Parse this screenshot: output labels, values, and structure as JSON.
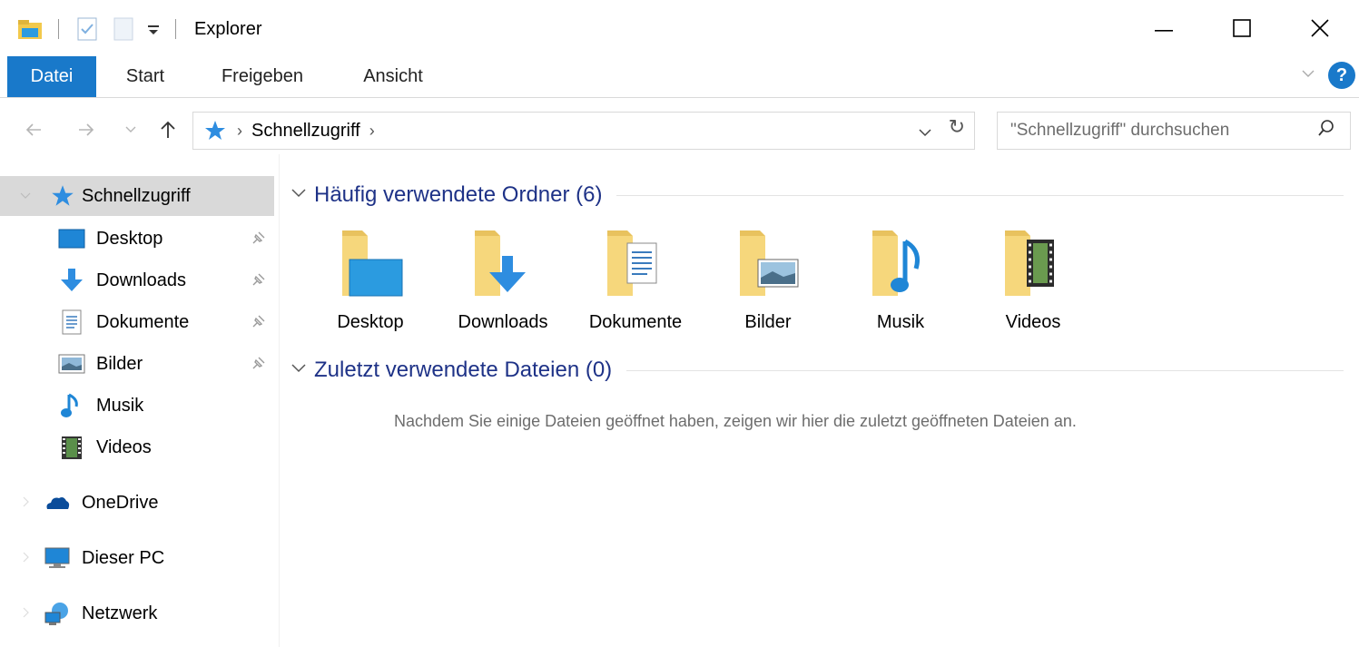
{
  "window": {
    "title": "Explorer",
    "controls": {
      "minimize": "—",
      "maximize": "☐",
      "close": "✕"
    }
  },
  "ribbon": {
    "tabs": [
      {
        "label": "Datei",
        "active": true
      },
      {
        "label": "Start",
        "active": false
      },
      {
        "label": "Freigeben",
        "active": false
      },
      {
        "label": "Ansicht",
        "active": false
      }
    ],
    "help": "?",
    "expand": "﹀"
  },
  "nav": {
    "back": "←",
    "forward": "→",
    "recent": "⌄",
    "up": "↑",
    "address_sep": "›",
    "address_location": "Schnellzugriff",
    "address_trailing_sep": "›",
    "dropdown": "⌄",
    "refresh": "↻",
    "search_placeholder": "\"Schnellzugriff\" durchsuchen",
    "search_icon": "⚲"
  },
  "sidebar": {
    "quick_access": "Schnellzugriff",
    "items": [
      {
        "label": "Desktop",
        "icon": "desktop-icon",
        "pinned": true
      },
      {
        "label": "Downloads",
        "icon": "downloads-icon",
        "pinned": true
      },
      {
        "label": "Dokumente",
        "icon": "documents-icon",
        "pinned": true
      },
      {
        "label": "Bilder",
        "icon": "pictures-icon",
        "pinned": true
      },
      {
        "label": "Musik",
        "icon": "music-icon",
        "pinned": false
      },
      {
        "label": "Videos",
        "icon": "videos-icon",
        "pinned": false
      }
    ],
    "roots": [
      {
        "label": "OneDrive",
        "icon": "onedrive-icon"
      },
      {
        "label": "Dieser PC",
        "icon": "this-pc-icon"
      },
      {
        "label": "Netzwerk",
        "icon": "network-icon"
      }
    ]
  },
  "main": {
    "frequent_header": "Häufig verwendete Ordner (6)",
    "folders": [
      {
        "label": "Desktop",
        "icon": "desktop-folder-icon"
      },
      {
        "label": "Downloads",
        "icon": "downloads-folder-icon"
      },
      {
        "label": "Dokumente",
        "icon": "documents-folder-icon"
      },
      {
        "label": "Bilder",
        "icon": "pictures-folder-icon"
      },
      {
        "label": "Musik",
        "icon": "music-folder-icon"
      },
      {
        "label": "Videos",
        "icon": "videos-folder-icon"
      }
    ],
    "recent_header": "Zuletzt verwendete Dateien (0)",
    "recent_empty": "Nachdem Sie einige Dateien geöffnet haben, zeigen wir hier die zuletzt geöffneten Dateien an."
  },
  "colors": {
    "accent": "#1979ca",
    "group_title": "#1e3287",
    "folder": "#f6d77c",
    "selection": "#d9d9d9"
  }
}
